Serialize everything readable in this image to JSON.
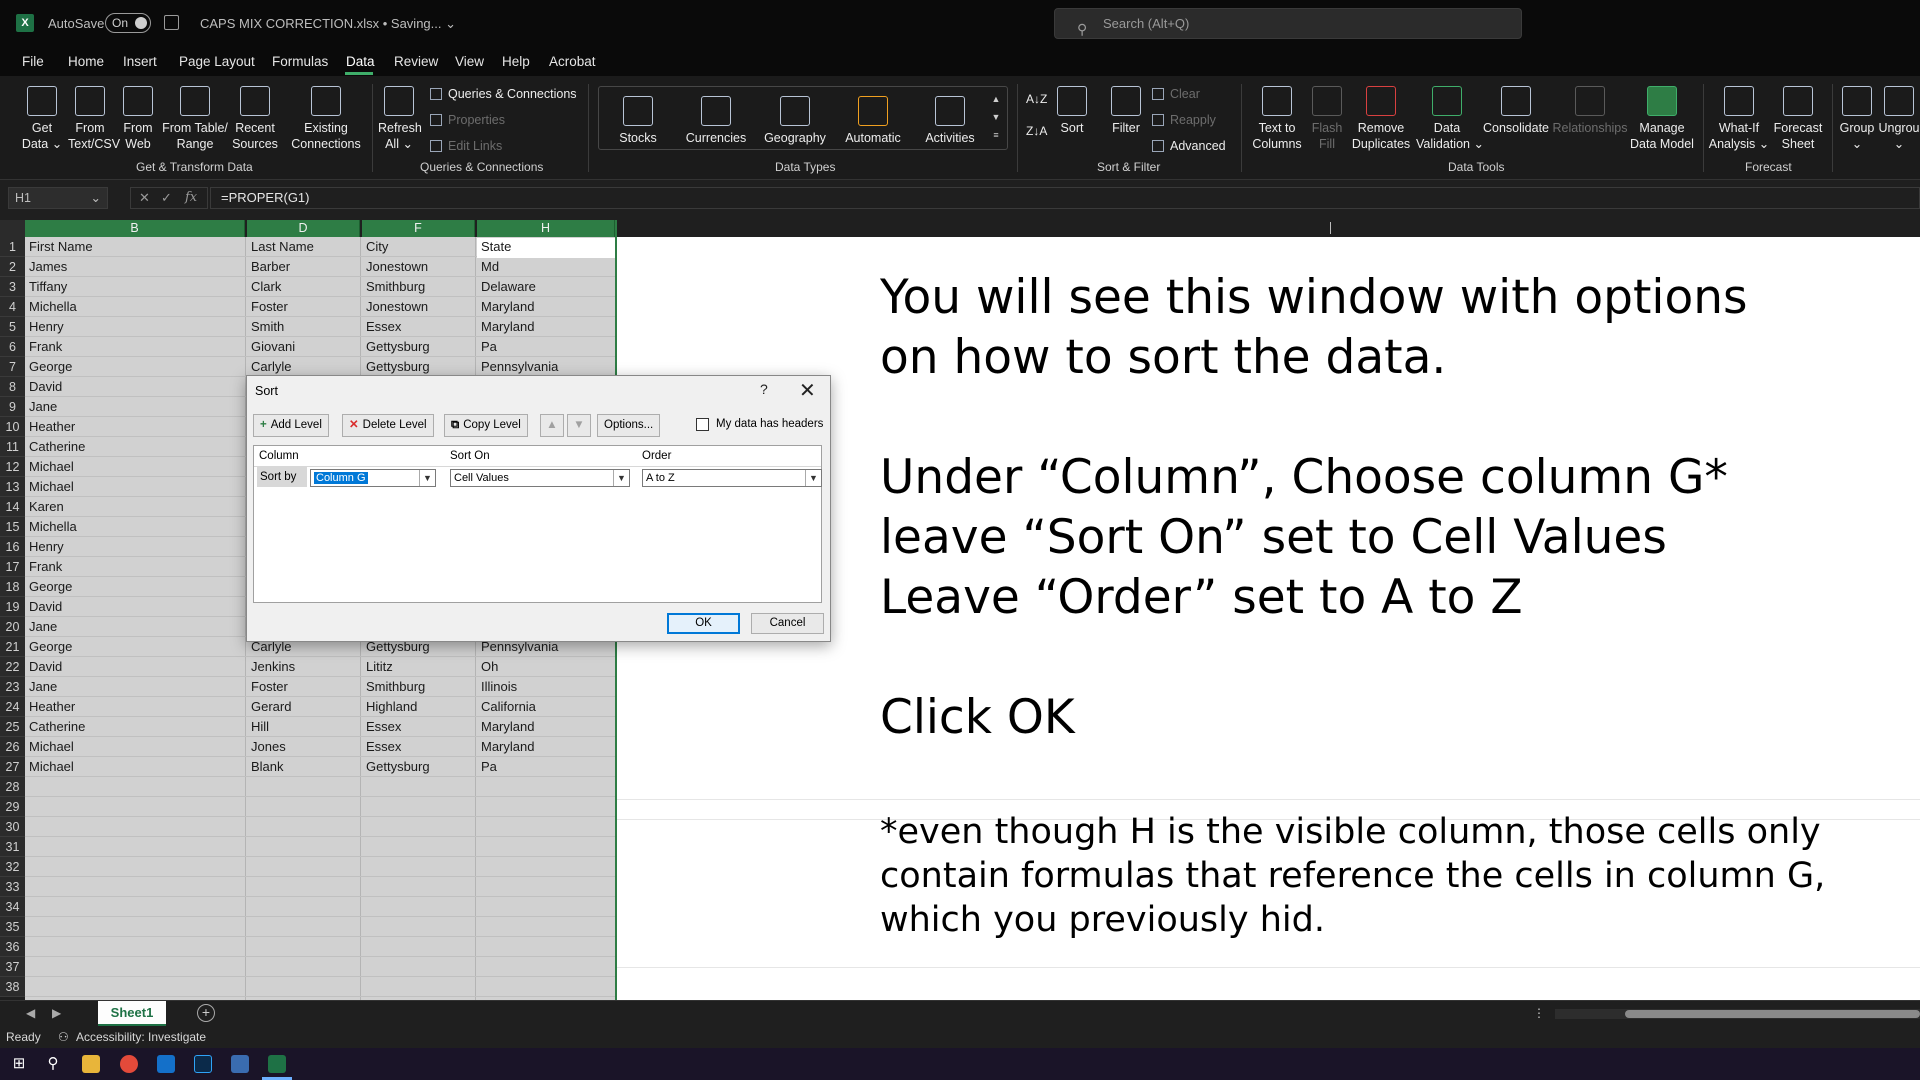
{
  "titlebar": {
    "autosave_label": "AutoSave",
    "autosave_state": "On",
    "document_title": "CAPS MIX CORRECTION.xlsx • Saving... ⌄",
    "search_placeholder": "Search (Alt+Q)"
  },
  "menu": {
    "tabs": [
      "File",
      "Home",
      "Insert",
      "Page Layout",
      "Formulas",
      "Data",
      "Review",
      "View",
      "Help",
      "Acrobat"
    ],
    "active": "Data"
  },
  "ribbon": {
    "get_transform": {
      "get_data": "Get\nData ⌄",
      "from_text_csv": "From\nText/CSV",
      "from_web": "From\nWeb",
      "from_table": "From Table/\nRange",
      "recent_sources": "Recent\nSources",
      "existing_connections": "Existing\nConnections",
      "group_label": "Get & Transform Data"
    },
    "queries": {
      "refresh_all": "Refresh\nAll ⌄",
      "queries_connections": "Queries & Connections",
      "properties": "Properties",
      "edit_links": "Edit Links",
      "group_label": "Queries & Connections"
    },
    "data_types": {
      "items": [
        "Stocks",
        "Currencies",
        "Geography",
        "Automatic",
        "Activities"
      ],
      "group_label": "Data Types"
    },
    "sort_filter": {
      "sort": "Sort",
      "filter": "Filter",
      "clear": "Clear",
      "reapply": "Reapply",
      "advanced": "Advanced",
      "group_label": "Sort & Filter"
    },
    "data_tools": {
      "text_to_columns": "Text to\nColumns",
      "flash_fill": "Flash\nFill",
      "remove_duplicates": "Remove\nDuplicates",
      "data_validation": "Data\nValidation ⌄",
      "consolidate": "Consolidate",
      "relationships": "Relationships",
      "manage_data_model": "Manage\nData Model",
      "group_label": "Data Tools"
    },
    "forecast": {
      "what_if": "What-If\nAnalysis ⌄",
      "forecast_sheet": "Forecast\nSheet",
      "group_label": "Forecast"
    },
    "outline": {
      "group": "Group\n⌄",
      "ungroup": "Ungrou\n⌄"
    }
  },
  "formula_bar": {
    "name_box": "H1",
    "formula": "=PROPER(G1)"
  },
  "grid": {
    "columns": [
      "B",
      "D",
      "F",
      "H"
    ],
    "row_numbers": [
      "1",
      "2",
      "3",
      "4",
      "5",
      "6",
      "7",
      "8",
      "9",
      "10",
      "11",
      "12",
      "13",
      "14",
      "15",
      "16",
      "17",
      "18",
      "19",
      "20",
      "21",
      "22",
      "23",
      "24",
      "25",
      "26",
      "27",
      "28",
      "29",
      "30",
      "31",
      "32",
      "33",
      "34",
      "35",
      "36",
      "37",
      "38"
    ],
    "rows": [
      [
        "First Name",
        "Last Name",
        "City",
        "State"
      ],
      [
        "James",
        "Barber",
        "Jonestown",
        "Md"
      ],
      [
        "Tiffany",
        "Clark",
        "Smithburg",
        "Delaware"
      ],
      [
        "Michella",
        "Foster",
        "Jonestown",
        "Maryland"
      ],
      [
        "Henry",
        "Smith",
        "Essex",
        "Maryland"
      ],
      [
        "Frank",
        "Giovani",
        "Gettysburg",
        "Pa"
      ],
      [
        "George",
        "Carlyle",
        "Gettysburg",
        "Pennsylvania"
      ],
      [
        "David",
        "",
        "",
        ""
      ],
      [
        "Jane",
        "",
        "",
        ""
      ],
      [
        "Heather",
        "",
        "",
        ""
      ],
      [
        "Catherine",
        "",
        "",
        ""
      ],
      [
        "Michael",
        "",
        "",
        ""
      ],
      [
        "Michael",
        "",
        "",
        ""
      ],
      [
        "Karen",
        "",
        "",
        ""
      ],
      [
        "Michella",
        "",
        "",
        ""
      ],
      [
        "Henry",
        "",
        "",
        ""
      ],
      [
        "Frank",
        "",
        "",
        ""
      ],
      [
        "George",
        "",
        "",
        ""
      ],
      [
        "David",
        "",
        "",
        ""
      ],
      [
        "Jane",
        "",
        "",
        ""
      ],
      [
        "George",
        "Carlyle",
        "Gettysburg",
        "Pennsylvania"
      ],
      [
        "David",
        "Jenkins",
        "Lititz",
        "Oh"
      ],
      [
        "Jane",
        "Foster",
        "Smithburg",
        "Illinois"
      ],
      [
        "Heather",
        "Gerard",
        "Highland",
        "California"
      ],
      [
        "Catherine",
        "Hill",
        "Essex",
        "Maryland"
      ],
      [
        "Michael",
        "Jones",
        "Essex",
        "Maryland"
      ],
      [
        "Michael",
        "Blank",
        "Gettysburg",
        "Pa"
      ]
    ]
  },
  "sort_dialog": {
    "title": "Sort",
    "help": "?",
    "close": "✕",
    "add_level": "Add Level",
    "delete_level": "Delete Level",
    "copy_level": "Copy Level",
    "move_up": "▲",
    "move_down": "▼",
    "options": "Options...",
    "headers_checkbox": "My data has headers",
    "headers_checked": false,
    "col_header_column": "Column",
    "col_header_sort_on": "Sort On",
    "col_header_order": "Order",
    "sort_by_label": "Sort by",
    "column_value": "Column G",
    "sort_on_value": "Cell Values",
    "order_value": "A to Z",
    "ok": "OK",
    "cancel": "Cancel"
  },
  "instructions": {
    "line1": "You will see this window with options",
    "line2": "on how to sort the data.",
    "line3": "Under “Column”, Choose column G*",
    "line4": "leave “Sort On” set to Cell Values",
    "line5": "Leave “Order” set to A to Z",
    "line6": "Click OK",
    "note1": "*even though H is the visible column, those cells only",
    "note2": "contain formulas that reference the cells in column G,",
    "note3": "which you previously hid."
  },
  "sheet_tabs": {
    "active": "Sheet1",
    "add": "+"
  },
  "status": {
    "ready": "Ready",
    "accessibility": "Accessibility: Investigate"
  },
  "colors": {
    "excel_green": "#1e7145",
    "header_green": "#2e7d45",
    "accent_blue": "#0078d7"
  }
}
